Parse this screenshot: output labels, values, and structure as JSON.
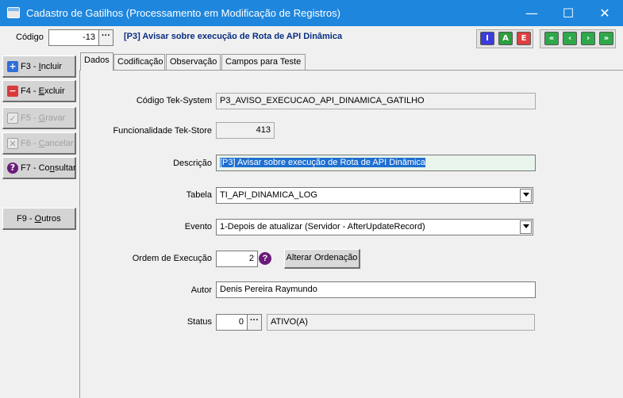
{
  "window": {
    "title": "Cadastro de Gatilhos (Processamento em Modificação de Registros)",
    "minimize": "—",
    "maximize": "☐",
    "close": "✕"
  },
  "toolbar": {
    "codigo_label": "Código",
    "codigo_value": "-13",
    "ellipsis": "···",
    "record_title": "[P3] Avisar sobre execução de Rota de API Dinâmica",
    "mode_buttons": [
      {
        "label": "I",
        "color": "#3b3bdc"
      },
      {
        "label": "A",
        "color": "#2e9e3e"
      },
      {
        "label": "E",
        "color": "#e04040"
      }
    ],
    "nav_buttons": [
      {
        "label": "«",
        "icon": "first-record-icon"
      },
      {
        "label": "‹",
        "icon": "prev-record-icon"
      },
      {
        "label": "›",
        "icon": "next-record-icon"
      },
      {
        "label": "»",
        "icon": "last-record-icon"
      }
    ],
    "nav_color": "#2ea84a"
  },
  "sidebar": {
    "incluir": {
      "prefix": "F3 - ",
      "hot": "I",
      "rest": "ncluir",
      "icon": "+",
      "color": "#2f6fd6"
    },
    "excluir": {
      "prefix": "F4 - ",
      "hot": "E",
      "rest": "xcluir",
      "icon": "−",
      "color": "#d93a3a"
    },
    "gravar": {
      "prefix": "F5 - ",
      "hot": "G",
      "rest": "ravar",
      "icon": "✓"
    },
    "cancelar": {
      "prefix": "F6 - ",
      "hot": "C",
      "rest": "ancelar",
      "icon": "✕"
    },
    "consultar": {
      "prefix": "F7 - Co",
      "hot": "n",
      "rest": "sultar",
      "icon": "?",
      "color": "#6a1b7a"
    },
    "outros": {
      "prefix": "F9 - ",
      "hot": "O",
      "rest": "utros"
    }
  },
  "tabs": [
    "Dados",
    "Codificação",
    "Observação",
    "Campos para Teste"
  ],
  "form": {
    "codigo_tek_label": "Código Tek-System",
    "codigo_tek_value": "P3_AVISO_EXECUCAO_API_DINAMICA_GATILHO",
    "funcionalidade_label": "Funcionalidade Tek-Store",
    "funcionalidade_value": "413",
    "descricao_label": "Descrição",
    "descricao_value": "[P3] Avisar sobre execução de Rota de API Dinâmica",
    "tabela_label": "Tabela",
    "tabela_value": "TI_API_DINAMICA_LOG",
    "evento_label": "Evento",
    "evento_value": "1-Depois de atualizar (Servidor - AfterUpdateRecord)",
    "ordem_label": "Ordem de Execução",
    "ordem_value": "2",
    "ordem_help": "?",
    "alterar_label": "Alterar Ordenação",
    "autor_label": "Autor",
    "autor_value": "Denis Pereira Raymundo",
    "status_label": "Status",
    "status_value": "0",
    "status_text": "ATIVO(A)"
  }
}
